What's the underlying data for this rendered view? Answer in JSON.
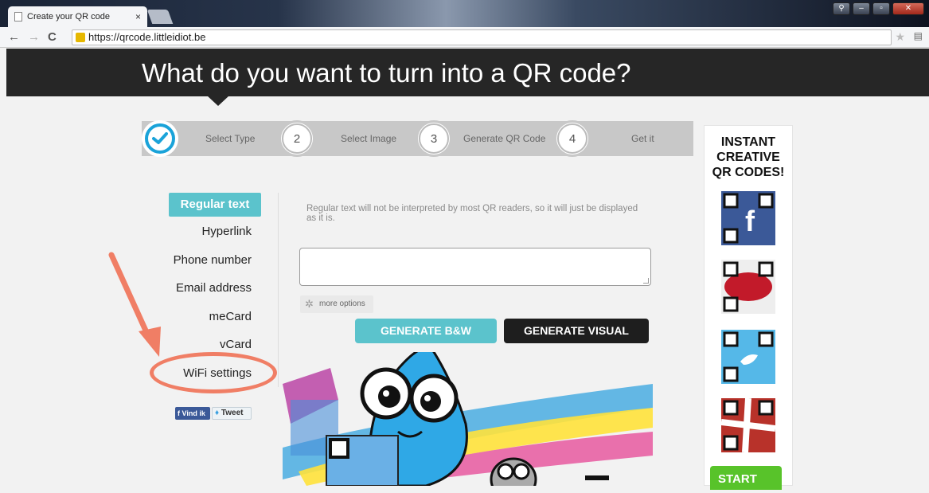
{
  "browser": {
    "tab_title": "Create your QR code",
    "tab_close": "×",
    "url": "https://qrcode.littleidiot.be",
    "back": "←",
    "forward": "→",
    "reload": "C"
  },
  "header": {
    "title": "What do you want to turn into a QR code?"
  },
  "steps": [
    {
      "number": "",
      "label": "Select Type",
      "done": true
    },
    {
      "number": "2",
      "label": "Select Image"
    },
    {
      "number": "3",
      "label": "Generate QR Code"
    },
    {
      "number": "4",
      "label": "Get it"
    }
  ],
  "types": {
    "active": "Regular text",
    "items": [
      "Hyperlink",
      "Phone number",
      "Email address",
      "meCard",
      "vCard",
      "WiFi settings"
    ]
  },
  "social": {
    "facebook": "Vind ik",
    "tweet": "Tweet"
  },
  "main": {
    "hint": "Regular text will not be interpreted by most QR readers, so it will just be displayed as it is.",
    "text_value": "",
    "more_options": "more options",
    "generate_bw": "GENERATE B&W",
    "generate_visual": "GENERATE VISUAL"
  },
  "ad": {
    "title_lines": [
      "INSTANT",
      "CREATIVE",
      "QR CODES!"
    ],
    "start": "START"
  },
  "colors": {
    "accent": "#5bc3cc",
    "step_check": "#1aa3d9",
    "annotation": "#f07e65",
    "header_bg": "#262626",
    "start_green": "#58c32a"
  }
}
